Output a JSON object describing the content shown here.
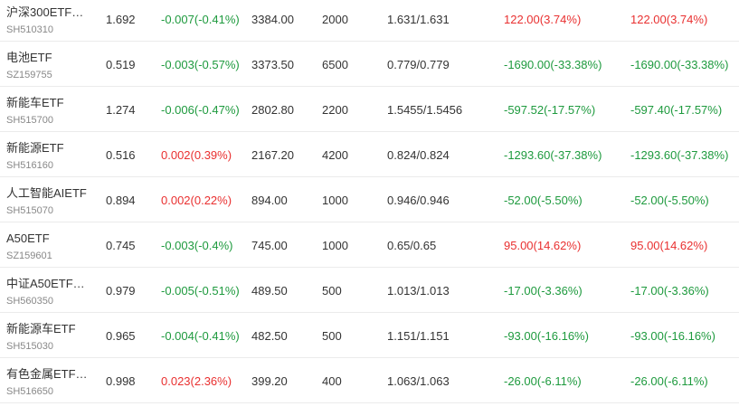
{
  "colors": {
    "up": "#e93030",
    "down": "#1e9a3e"
  },
  "rows": [
    {
      "name": "沪深300ETF…",
      "code": "SH510310",
      "price": "1.692",
      "change": "-0.007(-0.41%)",
      "change_dir": "down",
      "market_value": "3384.00",
      "shares": "2000",
      "cost": "1.631/1.631",
      "pnl1": "122.00(3.74%)",
      "pnl1_dir": "up",
      "pnl2": "122.00(3.74%)",
      "pnl2_dir": "up"
    },
    {
      "name": "电池ETF",
      "code": "SZ159755",
      "price": "0.519",
      "change": "-0.003(-0.57%)",
      "change_dir": "down",
      "market_value": "3373.50",
      "shares": "6500",
      "cost": "0.779/0.779",
      "pnl1": "-1690.00(-33.38%)",
      "pnl1_dir": "down",
      "pnl2": "-1690.00(-33.38%)",
      "pnl2_dir": "down"
    },
    {
      "name": "新能车ETF",
      "code": "SH515700",
      "price": "1.274",
      "change": "-0.006(-0.47%)",
      "change_dir": "down",
      "market_value": "2802.80",
      "shares": "2200",
      "cost": "1.5455/1.5456",
      "pnl1": "-597.52(-17.57%)",
      "pnl1_dir": "down",
      "pnl2": "-597.40(-17.57%)",
      "pnl2_dir": "down"
    },
    {
      "name": "新能源ETF",
      "code": "SH516160",
      "price": "0.516",
      "change": "0.002(0.39%)",
      "change_dir": "up",
      "market_value": "2167.20",
      "shares": "4200",
      "cost": "0.824/0.824",
      "pnl1": "-1293.60(-37.38%)",
      "pnl1_dir": "down",
      "pnl2": "-1293.60(-37.38%)",
      "pnl2_dir": "down"
    },
    {
      "name": "人工智能AIETF",
      "code": "SH515070",
      "price": "0.894",
      "change": "0.002(0.22%)",
      "change_dir": "up",
      "market_value": "894.00",
      "shares": "1000",
      "cost": "0.946/0.946",
      "pnl1": "-52.00(-5.50%)",
      "pnl1_dir": "down",
      "pnl2": "-52.00(-5.50%)",
      "pnl2_dir": "down"
    },
    {
      "name": "A50ETF",
      "code": "SZ159601",
      "price": "0.745",
      "change": "-0.003(-0.4%)",
      "change_dir": "down",
      "market_value": "745.00",
      "shares": "1000",
      "cost": "0.65/0.65",
      "pnl1": "95.00(14.62%)",
      "pnl1_dir": "up",
      "pnl2": "95.00(14.62%)",
      "pnl2_dir": "up"
    },
    {
      "name": "中证A50ETF…",
      "code": "SH560350",
      "price": "0.979",
      "change": "-0.005(-0.51%)",
      "change_dir": "down",
      "market_value": "489.50",
      "shares": "500",
      "cost": "1.013/1.013",
      "pnl1": "-17.00(-3.36%)",
      "pnl1_dir": "down",
      "pnl2": "-17.00(-3.36%)",
      "pnl2_dir": "down"
    },
    {
      "name": "新能源车ETF",
      "code": "SH515030",
      "price": "0.965",
      "change": "-0.004(-0.41%)",
      "change_dir": "down",
      "market_value": "482.50",
      "shares": "500",
      "cost": "1.151/1.151",
      "pnl1": "-93.00(-16.16%)",
      "pnl1_dir": "down",
      "pnl2": "-93.00(-16.16%)",
      "pnl2_dir": "down"
    },
    {
      "name": "有色金属ETF…",
      "code": "SH516650",
      "price": "0.998",
      "change": "0.023(2.36%)",
      "change_dir": "up",
      "market_value": "399.20",
      "shares": "400",
      "cost": "1.063/1.063",
      "pnl1": "-26.00(-6.11%)",
      "pnl1_dir": "down",
      "pnl2": "-26.00(-6.11%)",
      "pnl2_dir": "down"
    }
  ]
}
